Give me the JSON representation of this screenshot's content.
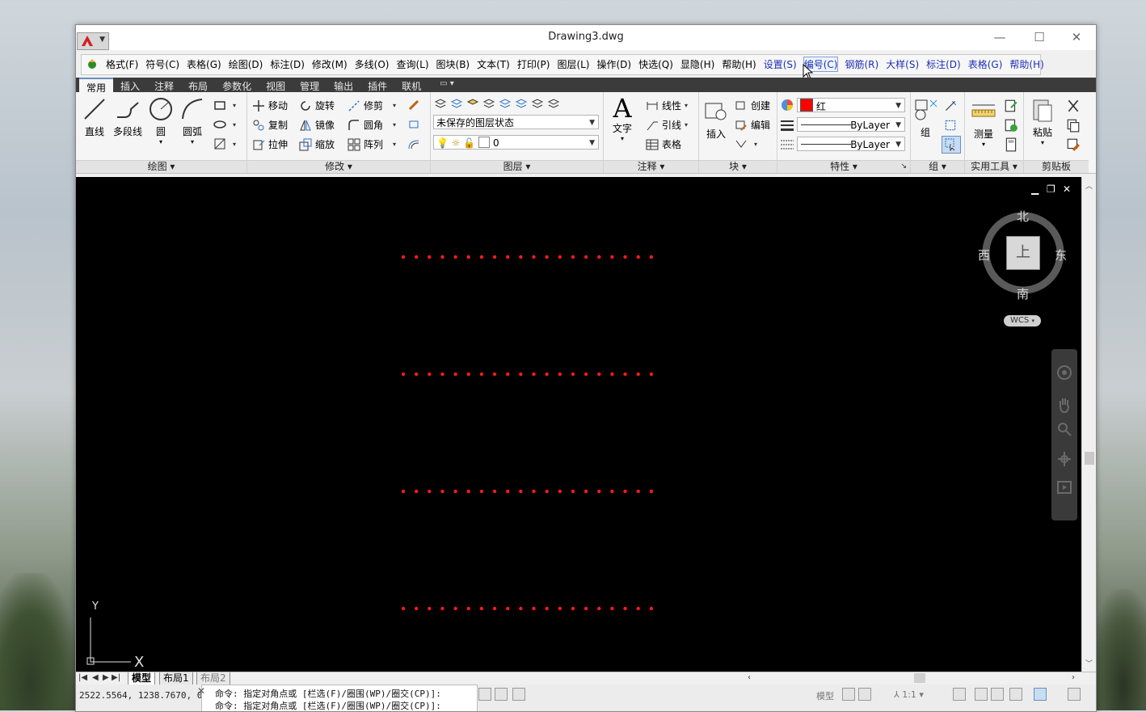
{
  "window": {
    "title": "Drawing3.dwg",
    "controls": {
      "minimize": "—",
      "maximize": "☐",
      "close": "✕"
    }
  },
  "menu": {
    "items": [
      {
        "label": "格式(F)",
        "blue": false
      },
      {
        "label": "符号(C)",
        "blue": false
      },
      {
        "label": "表格(G)",
        "blue": false
      },
      {
        "label": "绘图(D)",
        "blue": false
      },
      {
        "label": "标注(D)",
        "blue": false
      },
      {
        "label": "修改(M)",
        "blue": false
      },
      {
        "label": "多线(O)",
        "blue": false
      },
      {
        "label": "查询(L)",
        "blue": false
      },
      {
        "label": "图块(B)",
        "blue": false
      },
      {
        "label": "文本(T)",
        "blue": false
      },
      {
        "label": "打印(P)",
        "blue": false
      },
      {
        "label": "图层(L)",
        "blue": false
      },
      {
        "label": "操作(D)",
        "blue": false
      },
      {
        "label": "快选(Q)",
        "blue": false
      },
      {
        "label": "显隐(H)",
        "blue": false
      },
      {
        "label": "帮助(H)",
        "blue": false
      },
      {
        "label": "设置(S)",
        "blue": true
      },
      {
        "label": "编号(C)",
        "blue": true,
        "hover": true
      },
      {
        "label": "钢筋(R)",
        "blue": true
      },
      {
        "label": "大样(S)",
        "blue": true
      },
      {
        "label": "标注(D)",
        "blue": true
      },
      {
        "label": "表格(G)",
        "blue": true
      },
      {
        "label": "帮助(H)",
        "blue": true
      }
    ]
  },
  "ribbon_tabs": [
    "常用",
    "插入",
    "注释",
    "布局",
    "参数化",
    "视图",
    "管理",
    "输出",
    "插件",
    "联机"
  ],
  "ribbon_tab_extra": "▾",
  "draw_panel": {
    "title": "绘图 ▾",
    "line": "直线",
    "polyline": "多段线",
    "circle": "圆",
    "arc": "圆弧"
  },
  "modify_panel": {
    "title": "修改 ▾",
    "move": "移动",
    "rotate": "旋转",
    "trim": "修剪",
    "copy": "复制",
    "mirror": "镜像",
    "fillet": "圆角",
    "stretch": "拉伸",
    "scale": "缩放",
    "array": "阵列"
  },
  "layer_panel": {
    "title": "图层 ▾",
    "state": "未保存的图层状态",
    "current_layer": "0"
  },
  "annot_panel": {
    "title": "注释 ▾",
    "text": "文字",
    "dimension": "线性",
    "leader": "引线",
    "table": "表格"
  },
  "block_panel": {
    "title": "块 ▾",
    "insert": "插入",
    "create": "创建",
    "edit": "编辑"
  },
  "props_panel": {
    "title": "特性 ▾",
    "color_name": "红",
    "color_hex": "#ff0000",
    "linetype": "ByLayer",
    "lineweight": "ByLayer"
  },
  "group_panel": {
    "title": "组 ▾",
    "group": "组"
  },
  "util_panel": {
    "title": "实用工具 ▾",
    "measure": "测量"
  },
  "clip_panel": {
    "title": "剪贴板",
    "paste": "粘贴"
  },
  "viewcube": {
    "north": "北",
    "south": "南",
    "east": "东",
    "west": "西",
    "top": "上",
    "wcs": "WCS"
  },
  "viewport_controls": {
    "min": "▁",
    "restore": "❐",
    "close": "✕"
  },
  "ucs": {
    "y": "Y",
    "x": "X"
  },
  "layout_tabs": [
    "模型",
    "布局1",
    "布局2"
  ],
  "status": {
    "coords": "2522.5564, 1238.7670, 0.0000",
    "cmd_lines": [
      "命令: 指定对角点或 [栏选(F)/圈围(WP)/圈交(CP)]:",
      "命令: 指定对角点或 [栏选(F)/圈围(WP)/圈交(CP)]:"
    ],
    "model_label": "模型",
    "scale_label": "1:1"
  },
  "dot_color": "#ff1a1a",
  "dot_rows": 4,
  "dots_per_row": 20
}
